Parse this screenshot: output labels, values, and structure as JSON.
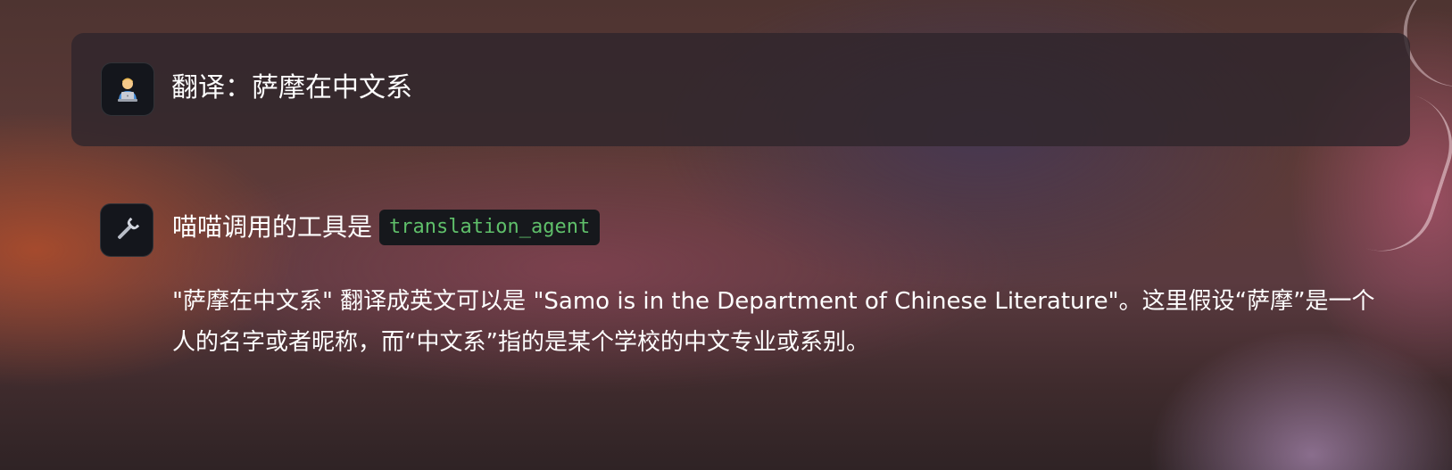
{
  "user_message": {
    "avatar_icon": "person-at-laptop-icon",
    "text": "翻译：萨摩在中文系"
  },
  "assistant_message": {
    "avatar_icon": "wrench-icon",
    "tool_prefix": "喵喵调用的工具是",
    "tool_name": "translation_agent",
    "answer": "\"萨摩在中文系\" 翻译成英文可以是 \"Samo is in the Department of Chinese Literature\"。这里假设“萨摩”是一个人的名字或者昵称，而“中文系”指的是某个学校的中文专业或系别。"
  },
  "colors": {
    "code_text": "#5fbf6a",
    "code_background": "#16181c",
    "avatar_background": "#14161c",
    "card_background": "#30262c"
  }
}
